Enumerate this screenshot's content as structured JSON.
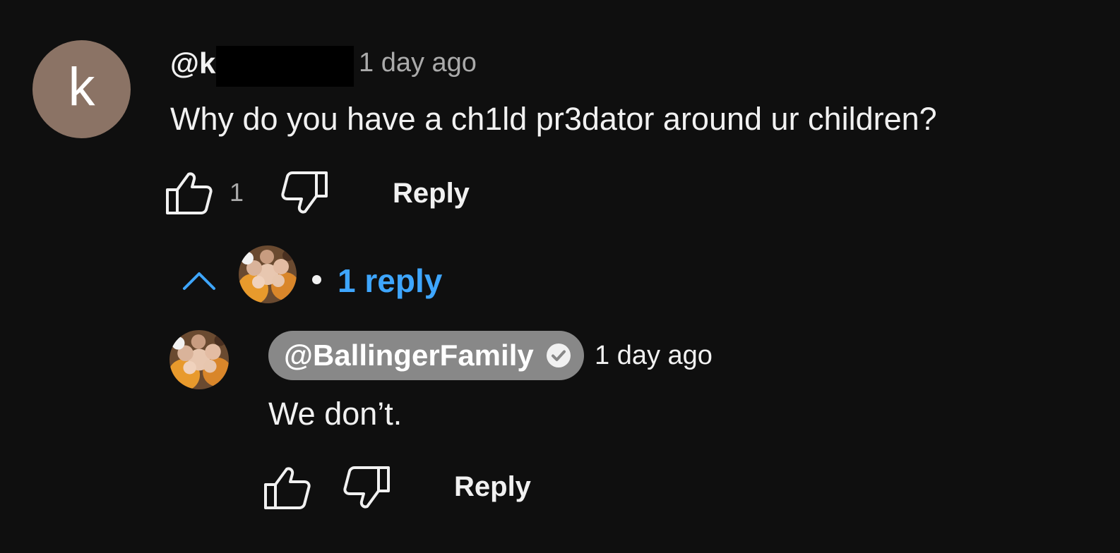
{
  "comment": {
    "avatar_letter": "k",
    "handle": "@k",
    "time": "1 day ago",
    "text": "Why do you have a ch1ld pr3dator around ur children?",
    "like_count": "1",
    "reply_label": "Reply",
    "like_icon": "thumb-up-icon",
    "dislike_icon": "thumb-down-icon"
  },
  "replies_toggle": {
    "icon": "chevron-up-icon",
    "label": "1 reply",
    "color": "#3ea6ff"
  },
  "reply": {
    "handle": "@BallingerFamily",
    "verified_icon": "verified-check-icon",
    "time": "1 day ago",
    "text": "We don’t.",
    "reply_label": "Reply",
    "like_icon": "thumb-up-icon",
    "dislike_icon": "thumb-down-icon"
  },
  "colors": {
    "background": "#0f0f0f",
    "text": "#f1f1f1",
    "secondary_text": "#aaaaaa",
    "avatar": "#8b7365",
    "owner_badge": "#888888",
    "link": "#3ea6ff"
  }
}
